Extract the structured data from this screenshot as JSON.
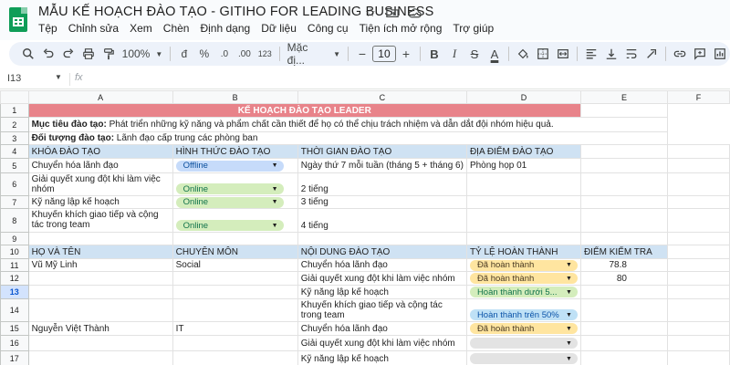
{
  "app": {
    "title": "MẪU KẾ HOẠCH ĐÀO TẠO - GITIHO FOR LEADING BUSINESS",
    "menu": [
      "Tệp",
      "Chỉnh sửa",
      "Xem",
      "Chèn",
      "Định dạng",
      "Dữ liệu",
      "Công cụ",
      "Tiện ích mở rộng",
      "Trợ giúp"
    ]
  },
  "toolbar": {
    "zoom": "100%",
    "currency": "đ",
    "percent": "%",
    "decimal_decrease": ".0",
    "decimal_increase": ".00",
    "number_format": "123",
    "font": "Mặc đị...",
    "font_size": "10",
    "minus": "−",
    "plus": "+",
    "bold": "B",
    "italic": "I",
    "strike": "S",
    "text_color": "A"
  },
  "formula": {
    "cell_ref": "I13",
    "fx": "fx",
    "value": ""
  },
  "columns": [
    "A",
    "B",
    "C",
    "D",
    "E",
    "F"
  ],
  "rows": {
    "r1": {
      "num": "1",
      "title": "KẾ HOẠCH ĐÀO TẠO LEADER"
    },
    "r2": {
      "num": "2",
      "label": "Mục tiêu đào tạo:",
      "text": " Phát triển những kỹ năng và phẩm chất cần thiết để họ có thể chịu trách nhiệm và dẫn dắt đội nhóm hiệu quả."
    },
    "r3": {
      "num": "3",
      "label": "Đối tượng đào tạo:",
      "text": " Lãnh đạo cấp trung các phòng ban"
    },
    "r4": {
      "num": "4",
      "a": "KHÓA ĐÀO TẠO",
      "b": "HÌNH THỨC ĐÀO TẠO",
      "c": "THỜI GIAN ĐÀO TẠO",
      "d": "ĐỊA ĐIỂM ĐÀO TẠO"
    },
    "r5": {
      "num": "5",
      "a": "Chuyển hóa lãnh đạo",
      "b": "Offline",
      "c": "Ngày thứ 7 mỗi tuần (tháng 5 + tháng 6)",
      "d": "Phòng họp 01"
    },
    "r6": {
      "num": "6",
      "a": "Giải quyết xung đột khi làm việc nhóm",
      "b": "Online",
      "c": "2 tiếng"
    },
    "r7": {
      "num": "7",
      "a": "Kỹ năng lập kế hoạch",
      "b": "Online",
      "c": "3 tiếng"
    },
    "r8": {
      "num": "8",
      "a": "Khuyến khích giao tiếp và cộng tác trong team",
      "b": "Online",
      "c": "4 tiếng"
    },
    "r9": {
      "num": "9"
    },
    "r10": {
      "num": "10",
      "a": "HỌ VÀ TÊN",
      "b": "CHUYÊN MÔN",
      "c": "NỘI DUNG ĐÀO TẠO",
      "d": "TỶ LỆ HOÀN THÀNH",
      "e": "ĐIỂM KIỂM TRA"
    },
    "r11": {
      "num": "11",
      "a": "Vũ Mỹ Linh",
      "b": "Social",
      "c": "Chuyển hóa lãnh đạo",
      "d": "Đã hoàn thành",
      "e": "78.8"
    },
    "r12": {
      "num": "12",
      "c": "Giải quyết xung đột khi làm việc nhóm",
      "d": "Đã hoàn thành",
      "e": "80"
    },
    "r13": {
      "num": "13",
      "c": "Kỹ năng lập kế hoạch",
      "d": "Hoàn thành dưới 5..."
    },
    "r14": {
      "num": "14",
      "c": "Khuyến khích giao tiếp và cộng tác trong team",
      "d": "Hoàn thành trên 50%"
    },
    "r15": {
      "num": "15",
      "a": "Nguyễn Việt Thành",
      "b": "IT",
      "c": "Chuyển hóa lãnh đạo",
      "d": "Đã hoàn thành"
    },
    "r16": {
      "num": "16",
      "c": "Giải quyết xung đột khi làm việc nhóm",
      "d": ""
    },
    "r17": {
      "num": "17",
      "c": "Kỹ năng lập kế hoạch",
      "d": ""
    },
    "r18": {
      "num": "18"
    }
  },
  "colors": {
    "title_bg": "#e8838a",
    "header_bg": "#cfe2f3",
    "chip_offline": "#c6dbfa",
    "chip_online": "#d4edbc",
    "chip_done": "#ffe5a0",
    "chip_over": "#bfe1f6",
    "chip_empty": "#e3e3e3"
  }
}
